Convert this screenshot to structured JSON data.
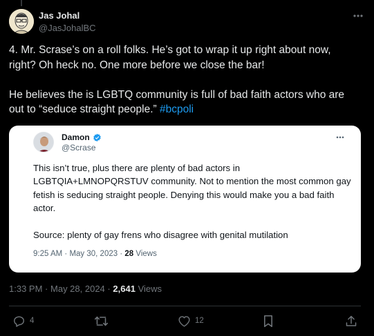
{
  "tweet": {
    "author_name": "Jas Johal",
    "author_handle": "@JasJohalBC",
    "paragraph1": "4. Mr. Scrase’s on a roll folks. He’s got to wrap it up right about now, right? Oh heck no.  One more before we close the bar!",
    "paragraph2_text": "He believes the is LGBTQ community is full of bad faith actors who are out to “seduce straight people.” ",
    "hashtag": "#bcpoli",
    "time": "1:33 PM",
    "date": "May 28, 2024",
    "views_count": "2,641",
    "views_label": "Views",
    "separator": "·"
  },
  "quote": {
    "author_name": "Damon",
    "author_handle": "@Scrase",
    "text": "This isn’t true, plus there are plenty of bad actors in LGBTQIA+LMNOPQRSTUV community. Not to mention the most common gay fetish is seducing straight people. Denying this would make you a bad faith actor.",
    "source": "Source: plenty of gay frens who disagree with genital mutilation",
    "time": "9:25 AM",
    "date": "May 30, 2023",
    "views_count": "28",
    "views_label": "Views"
  },
  "actions": {
    "reply_count": "4",
    "like_count": "12"
  },
  "icons": {
    "more": "more-horizontal-icon",
    "verified": "verified-badge-icon",
    "reply": "reply-icon",
    "retweet": "retweet-icon",
    "like": "heart-icon",
    "bookmark": "bookmark-icon",
    "share": "share-icon"
  },
  "colors": {
    "background": "#000000",
    "text": "#e7e9ea",
    "secondary": "#71767b",
    "link": "#1d9bf0",
    "verified": "#1d9bf0"
  }
}
